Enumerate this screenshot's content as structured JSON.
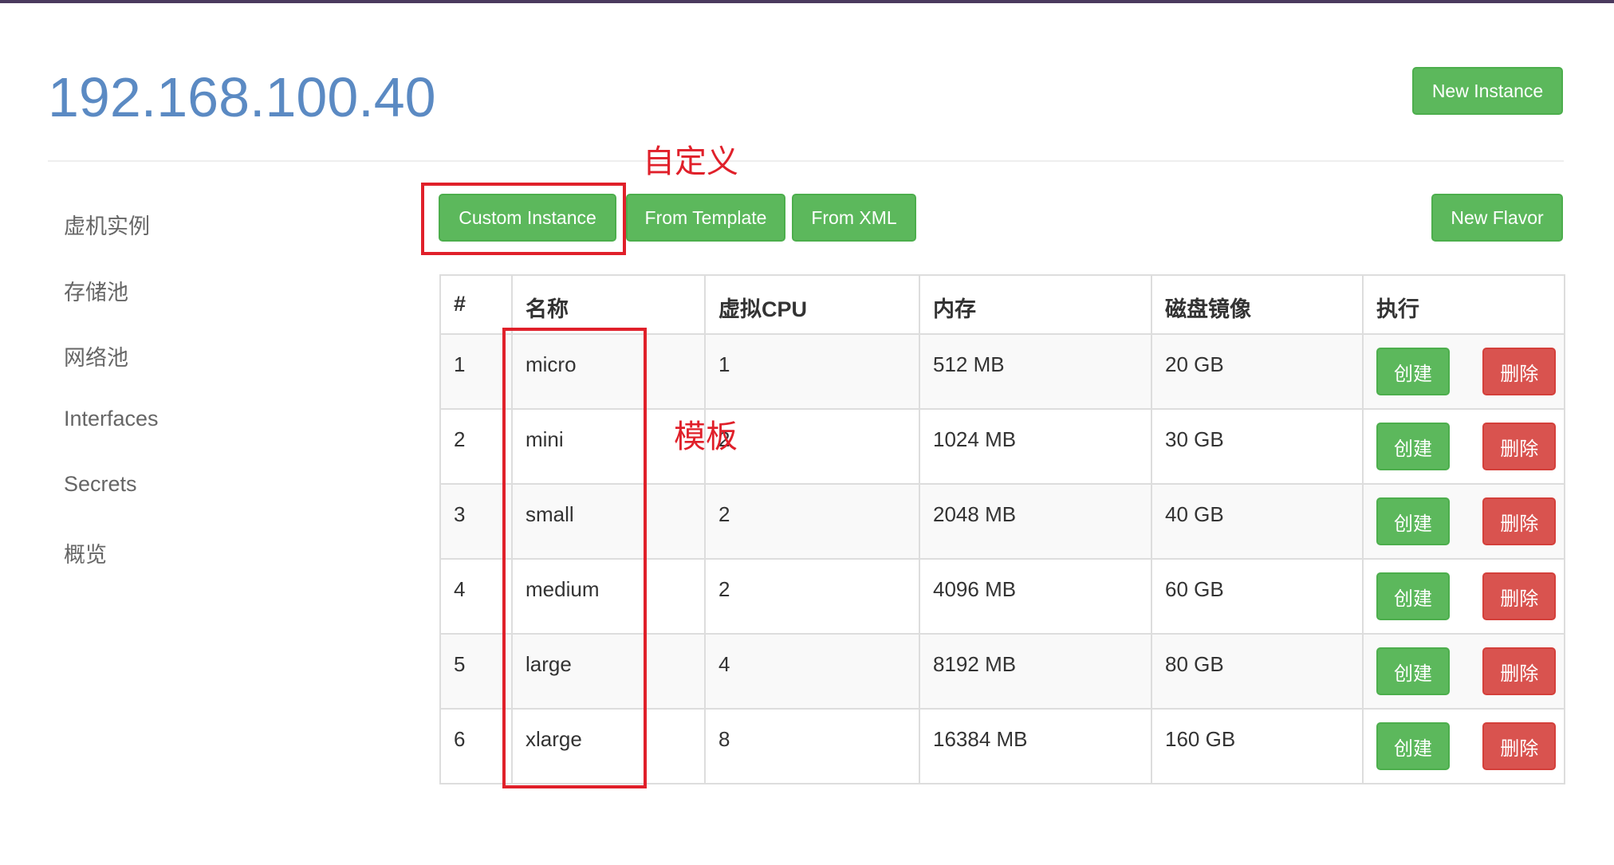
{
  "page": {
    "host_title": "192.168.100.40",
    "colors": {
      "primary_title": "#5b8ac3",
      "success": "#5cb85c",
      "danger": "#d9534f",
      "annotation": "#e0202a"
    }
  },
  "header": {
    "new_instance_label": "New Instance"
  },
  "toolbar": {
    "custom_instance_label": "Custom Instance",
    "from_template_label": "From Template",
    "from_xml_label": "From XML",
    "new_flavor_label": "New Flavor"
  },
  "sidebar": {
    "items": [
      {
        "label": "虚机实例"
      },
      {
        "label": "存储池"
      },
      {
        "label": "网络池"
      },
      {
        "label": "Interfaces"
      },
      {
        "label": "Secrets"
      },
      {
        "label": "概览"
      }
    ]
  },
  "table": {
    "headers": [
      "#",
      "名称",
      "虚拟CPU",
      "内存",
      "磁盘镜像",
      "执行"
    ],
    "rows": [
      {
        "id": "1",
        "name": "micro",
        "vcpu": "1",
        "memory": "512 MB",
        "disk": "20 GB",
        "create": "创建",
        "delete": "删除"
      },
      {
        "id": "2",
        "name": "mini",
        "vcpu": "2",
        "memory": "1024 MB",
        "disk": "30 GB",
        "create": "创建",
        "delete": "删除"
      },
      {
        "id": "3",
        "name": "small",
        "vcpu": "2",
        "memory": "2048 MB",
        "disk": "40 GB",
        "create": "创建",
        "delete": "删除"
      },
      {
        "id": "4",
        "name": "medium",
        "vcpu": "2",
        "memory": "4096 MB",
        "disk": "60 GB",
        "create": "创建",
        "delete": "删除"
      },
      {
        "id": "5",
        "name": "large",
        "vcpu": "4",
        "memory": "8192 MB",
        "disk": "80 GB",
        "create": "创建",
        "delete": "删除"
      },
      {
        "id": "6",
        "name": "xlarge",
        "vcpu": "8",
        "memory": "16384 MB",
        "disk": "160 GB",
        "create": "创建",
        "delete": "删除"
      }
    ]
  },
  "annotations": {
    "custom_label": "自定义",
    "template_label": "模板"
  }
}
